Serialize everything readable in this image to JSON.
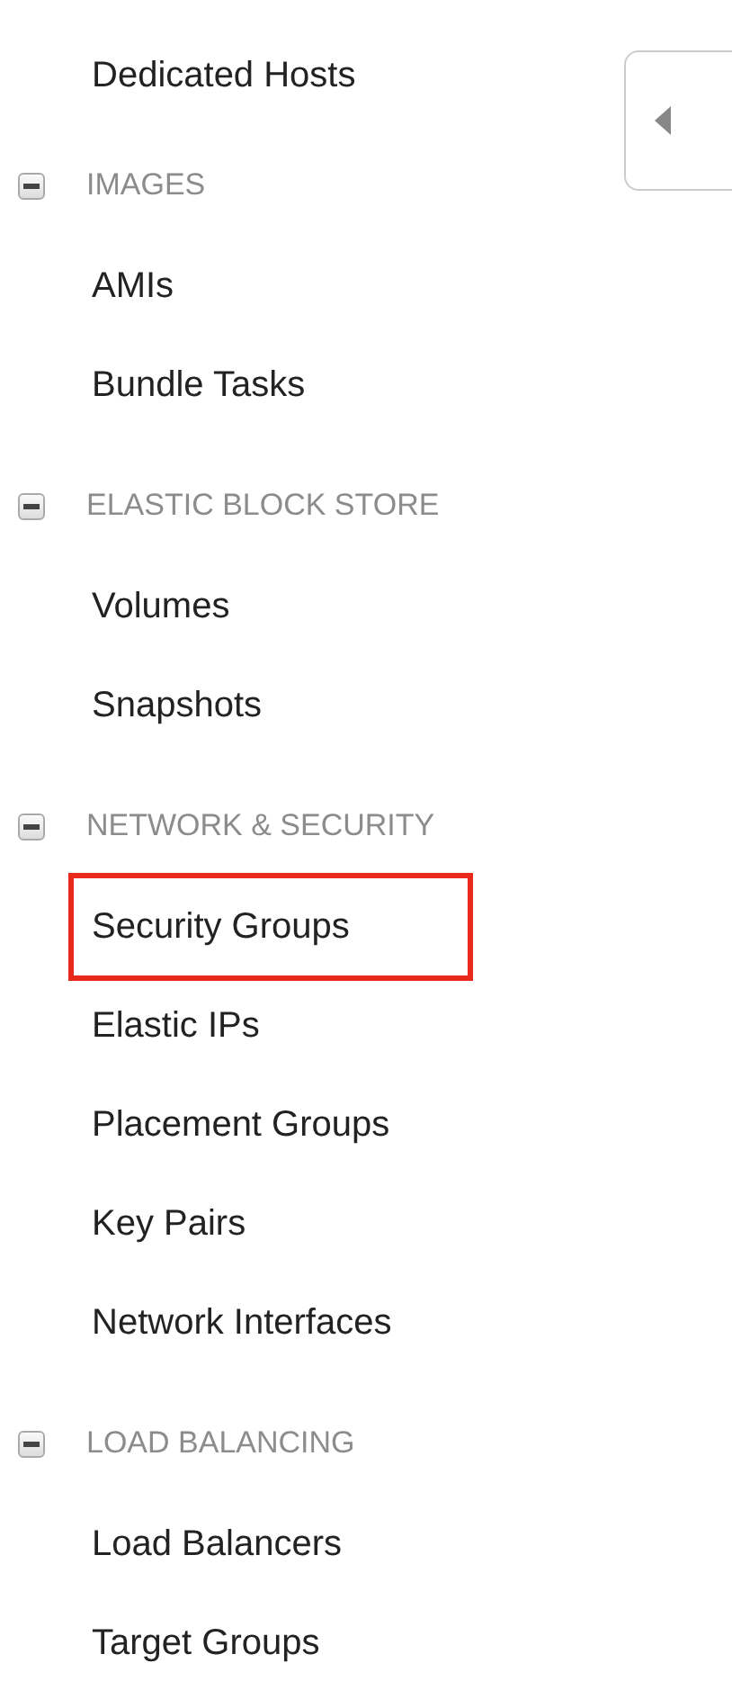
{
  "top_items": [
    {
      "label": "Dedicated Hosts",
      "highlighted": false
    }
  ],
  "sections": [
    {
      "title": "IMAGES",
      "expanded": true,
      "items": [
        {
          "label": "AMIs",
          "highlighted": false
        },
        {
          "label": "Bundle Tasks",
          "highlighted": false
        }
      ]
    },
    {
      "title": "ELASTIC BLOCK STORE",
      "expanded": true,
      "items": [
        {
          "label": "Volumes",
          "highlighted": false
        },
        {
          "label": "Snapshots",
          "highlighted": false
        }
      ]
    },
    {
      "title": "NETWORK & SECURITY",
      "expanded": true,
      "items": [
        {
          "label": "Security Groups",
          "highlighted": true
        },
        {
          "label": "Elastic IPs",
          "highlighted": false
        },
        {
          "label": "Placement Groups",
          "highlighted": false
        },
        {
          "label": "Key Pairs",
          "highlighted": false
        },
        {
          "label": "Network Interfaces",
          "highlighted": false
        }
      ]
    },
    {
      "title": "LOAD BALANCING",
      "expanded": true,
      "items": [
        {
          "label": "Load Balancers",
          "highlighted": false
        },
        {
          "label": "Target Groups",
          "highlighted": false
        }
      ]
    }
  ]
}
